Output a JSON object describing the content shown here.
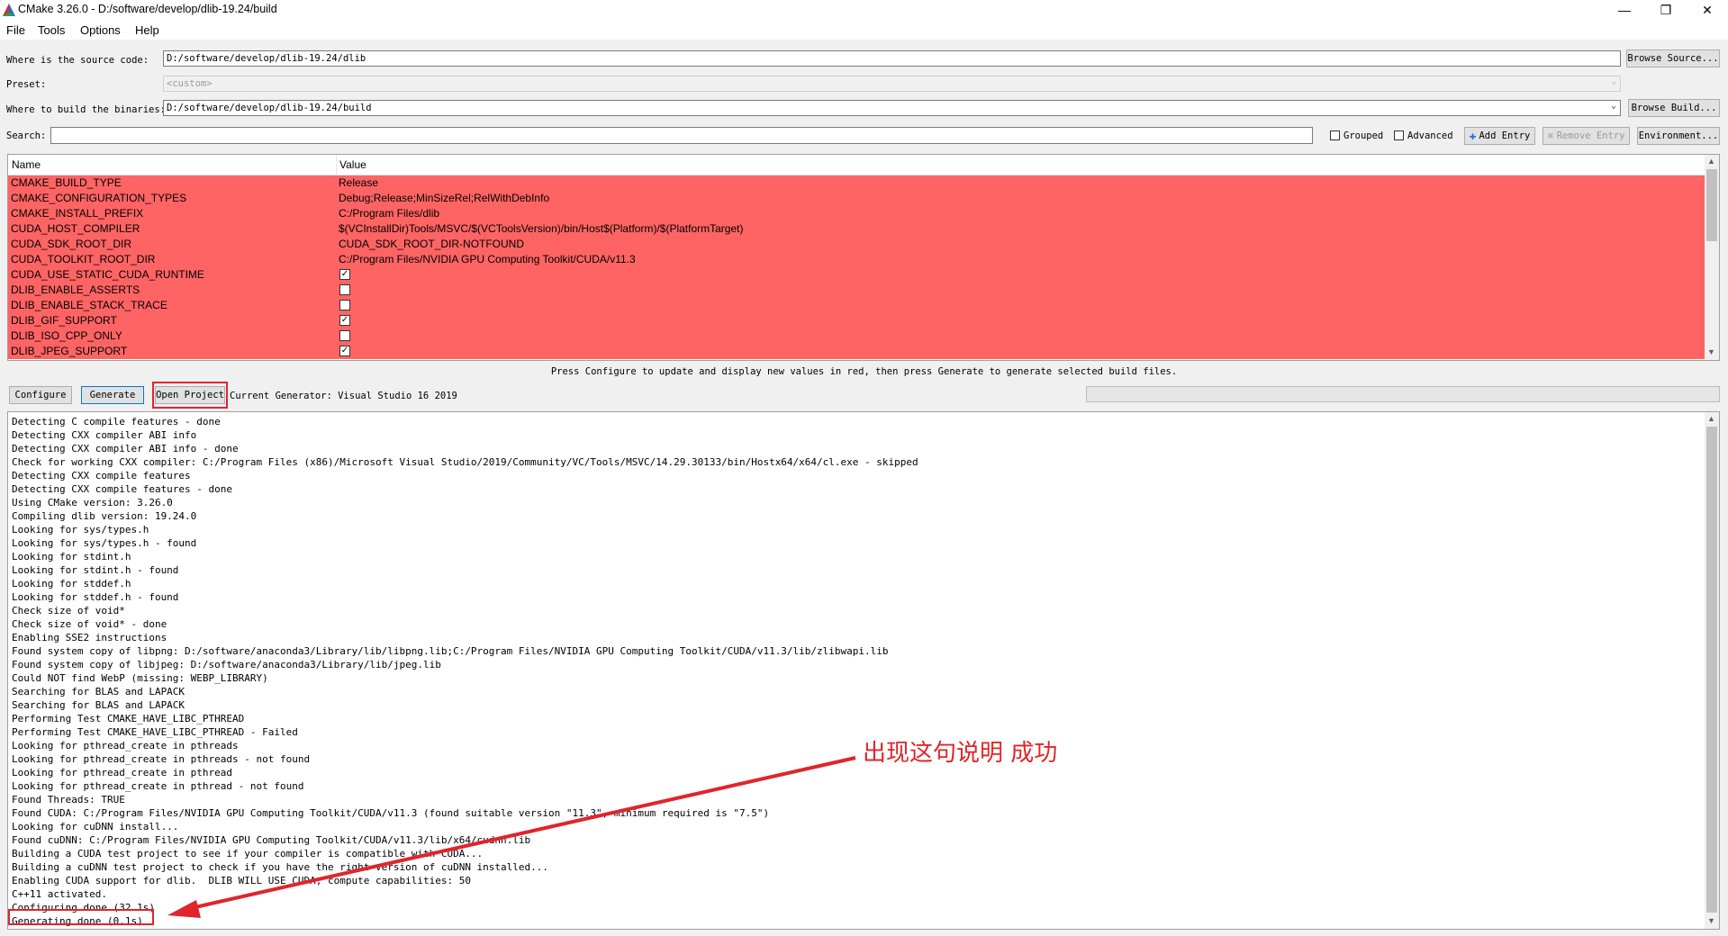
{
  "window": {
    "title": "CMake 3.26.0 - D:/software/develop/dlib-19.24/build",
    "controls": [
      "—",
      "❐",
      "✕"
    ]
  },
  "menu": [
    "File",
    "Tools",
    "Options",
    "Help"
  ],
  "source": {
    "label": "Where is the source code:",
    "value": "D:/software/develop/dlib-19.24/dlib",
    "button": "Browse Source..."
  },
  "preset": {
    "label": "Preset:",
    "value": "<custom>"
  },
  "binaries": {
    "label": "Where to build the binaries:",
    "value": "D:/software/develop/dlib-19.24/build",
    "button": "Browse Build..."
  },
  "search": {
    "label": "Search:",
    "value": "",
    "grouped": "Grouped",
    "advanced": "Advanced",
    "add_entry": "Add Entry",
    "remove_entry": "Remove Entry",
    "environment": "Environment..."
  },
  "table": {
    "headers": [
      "Name",
      "Value"
    ],
    "rows": [
      {
        "name": "CMAKE_BUILD_TYPE",
        "value": "Release"
      },
      {
        "name": "CMAKE_CONFIGURATION_TYPES",
        "value": "Debug;Release;MinSizeRel;RelWithDebInfo"
      },
      {
        "name": "CMAKE_INSTALL_PREFIX",
        "value": "C:/Program Files/dlib"
      },
      {
        "name": "CUDA_HOST_COMPILER",
        "value": "$(VCInstallDir)Tools/MSVC/$(VCToolsVersion)/bin/Host$(Platform)/$(PlatformTarget)"
      },
      {
        "name": "CUDA_SDK_ROOT_DIR",
        "value": "CUDA_SDK_ROOT_DIR-NOTFOUND"
      },
      {
        "name": "CUDA_TOOLKIT_ROOT_DIR",
        "value": "C:/Program Files/NVIDIA GPU Computing Toolkit/CUDA/v11.3"
      },
      {
        "name": "CUDA_USE_STATIC_CUDA_RUNTIME",
        "checked": true
      },
      {
        "name": "DLIB_ENABLE_ASSERTS",
        "checked": false
      },
      {
        "name": "DLIB_ENABLE_STACK_TRACE",
        "checked": false
      },
      {
        "name": "DLIB_GIF_SUPPORT",
        "checked": true
      },
      {
        "name": "DLIB_ISO_CPP_ONLY",
        "checked": false
      },
      {
        "name": "DLIB_JPEG_SUPPORT",
        "checked": true
      }
    ]
  },
  "hint": "Press Configure to update and display new values in red, then press Generate to generate selected build files.",
  "actions": {
    "configure": "Configure",
    "generate": "Generate",
    "open_project": "Open Project",
    "generator": "Current Generator: Visual Studio 16 2019"
  },
  "log": [
    "Detecting C compile features - done",
    "Detecting CXX compiler ABI info",
    "Detecting CXX compiler ABI info - done",
    "Check for working CXX compiler: C:/Program Files (x86)/Microsoft Visual Studio/2019/Community/VC/Tools/MSVC/14.29.30133/bin/Hostx64/x64/cl.exe - skipped",
    "Detecting CXX compile features",
    "Detecting CXX compile features - done",
    "Using CMake version: 3.26.0",
    "Compiling dlib version: 19.24.0",
    "Looking for sys/types.h",
    "Looking for sys/types.h - found",
    "Looking for stdint.h",
    "Looking for stdint.h - found",
    "Looking for stddef.h",
    "Looking for stddef.h - found",
    "Check size of void*",
    "Check size of void* - done",
    "Enabling SSE2 instructions",
    "Found system copy of libpng: D:/software/anaconda3/Library/lib/libpng.lib;C:/Program Files/NVIDIA GPU Computing Toolkit/CUDA/v11.3/lib/zlibwapi.lib",
    "Found system copy of libjpeg: D:/software/anaconda3/Library/lib/jpeg.lib",
    "Could NOT find WebP (missing: WEBP_LIBRARY)",
    "Searching for BLAS and LAPACK",
    "Searching for BLAS and LAPACK",
    "Performing Test CMAKE_HAVE_LIBC_PTHREAD",
    "Performing Test CMAKE_HAVE_LIBC_PTHREAD - Failed",
    "Looking for pthread_create in pthreads",
    "Looking for pthread_create in pthreads - not found",
    "Looking for pthread_create in pthread",
    "Looking for pthread_create in pthread - not found",
    "Found Threads: TRUE",
    "Found CUDA: C:/Program Files/NVIDIA GPU Computing Toolkit/CUDA/v11.3 (found suitable version \"11.3\", minimum required is \"7.5\")",
    "Looking for cuDNN install...",
    "Found cuDNN: C:/Program Files/NVIDIA GPU Computing Toolkit/CUDA/v11.3/lib/x64/cudnn.lib",
    "Building a CUDA test project to see if your compiler is compatible with CUDA...",
    "Building a cuDNN test project to check if you have the right version of cuDNN installed...",
    "Enabling CUDA support for dlib.  DLIB WILL USE CUDA, compute capabilities: 50",
    "C++11 activated.",
    "Configuring done (32.1s)",
    "Generating done (0.1s)"
  ],
  "annotation": {
    "text": "出现这句说明 成功",
    "color": "#e0252b"
  },
  "colors": {
    "changed_row": "#ff6464",
    "accent": "#0078d7"
  }
}
